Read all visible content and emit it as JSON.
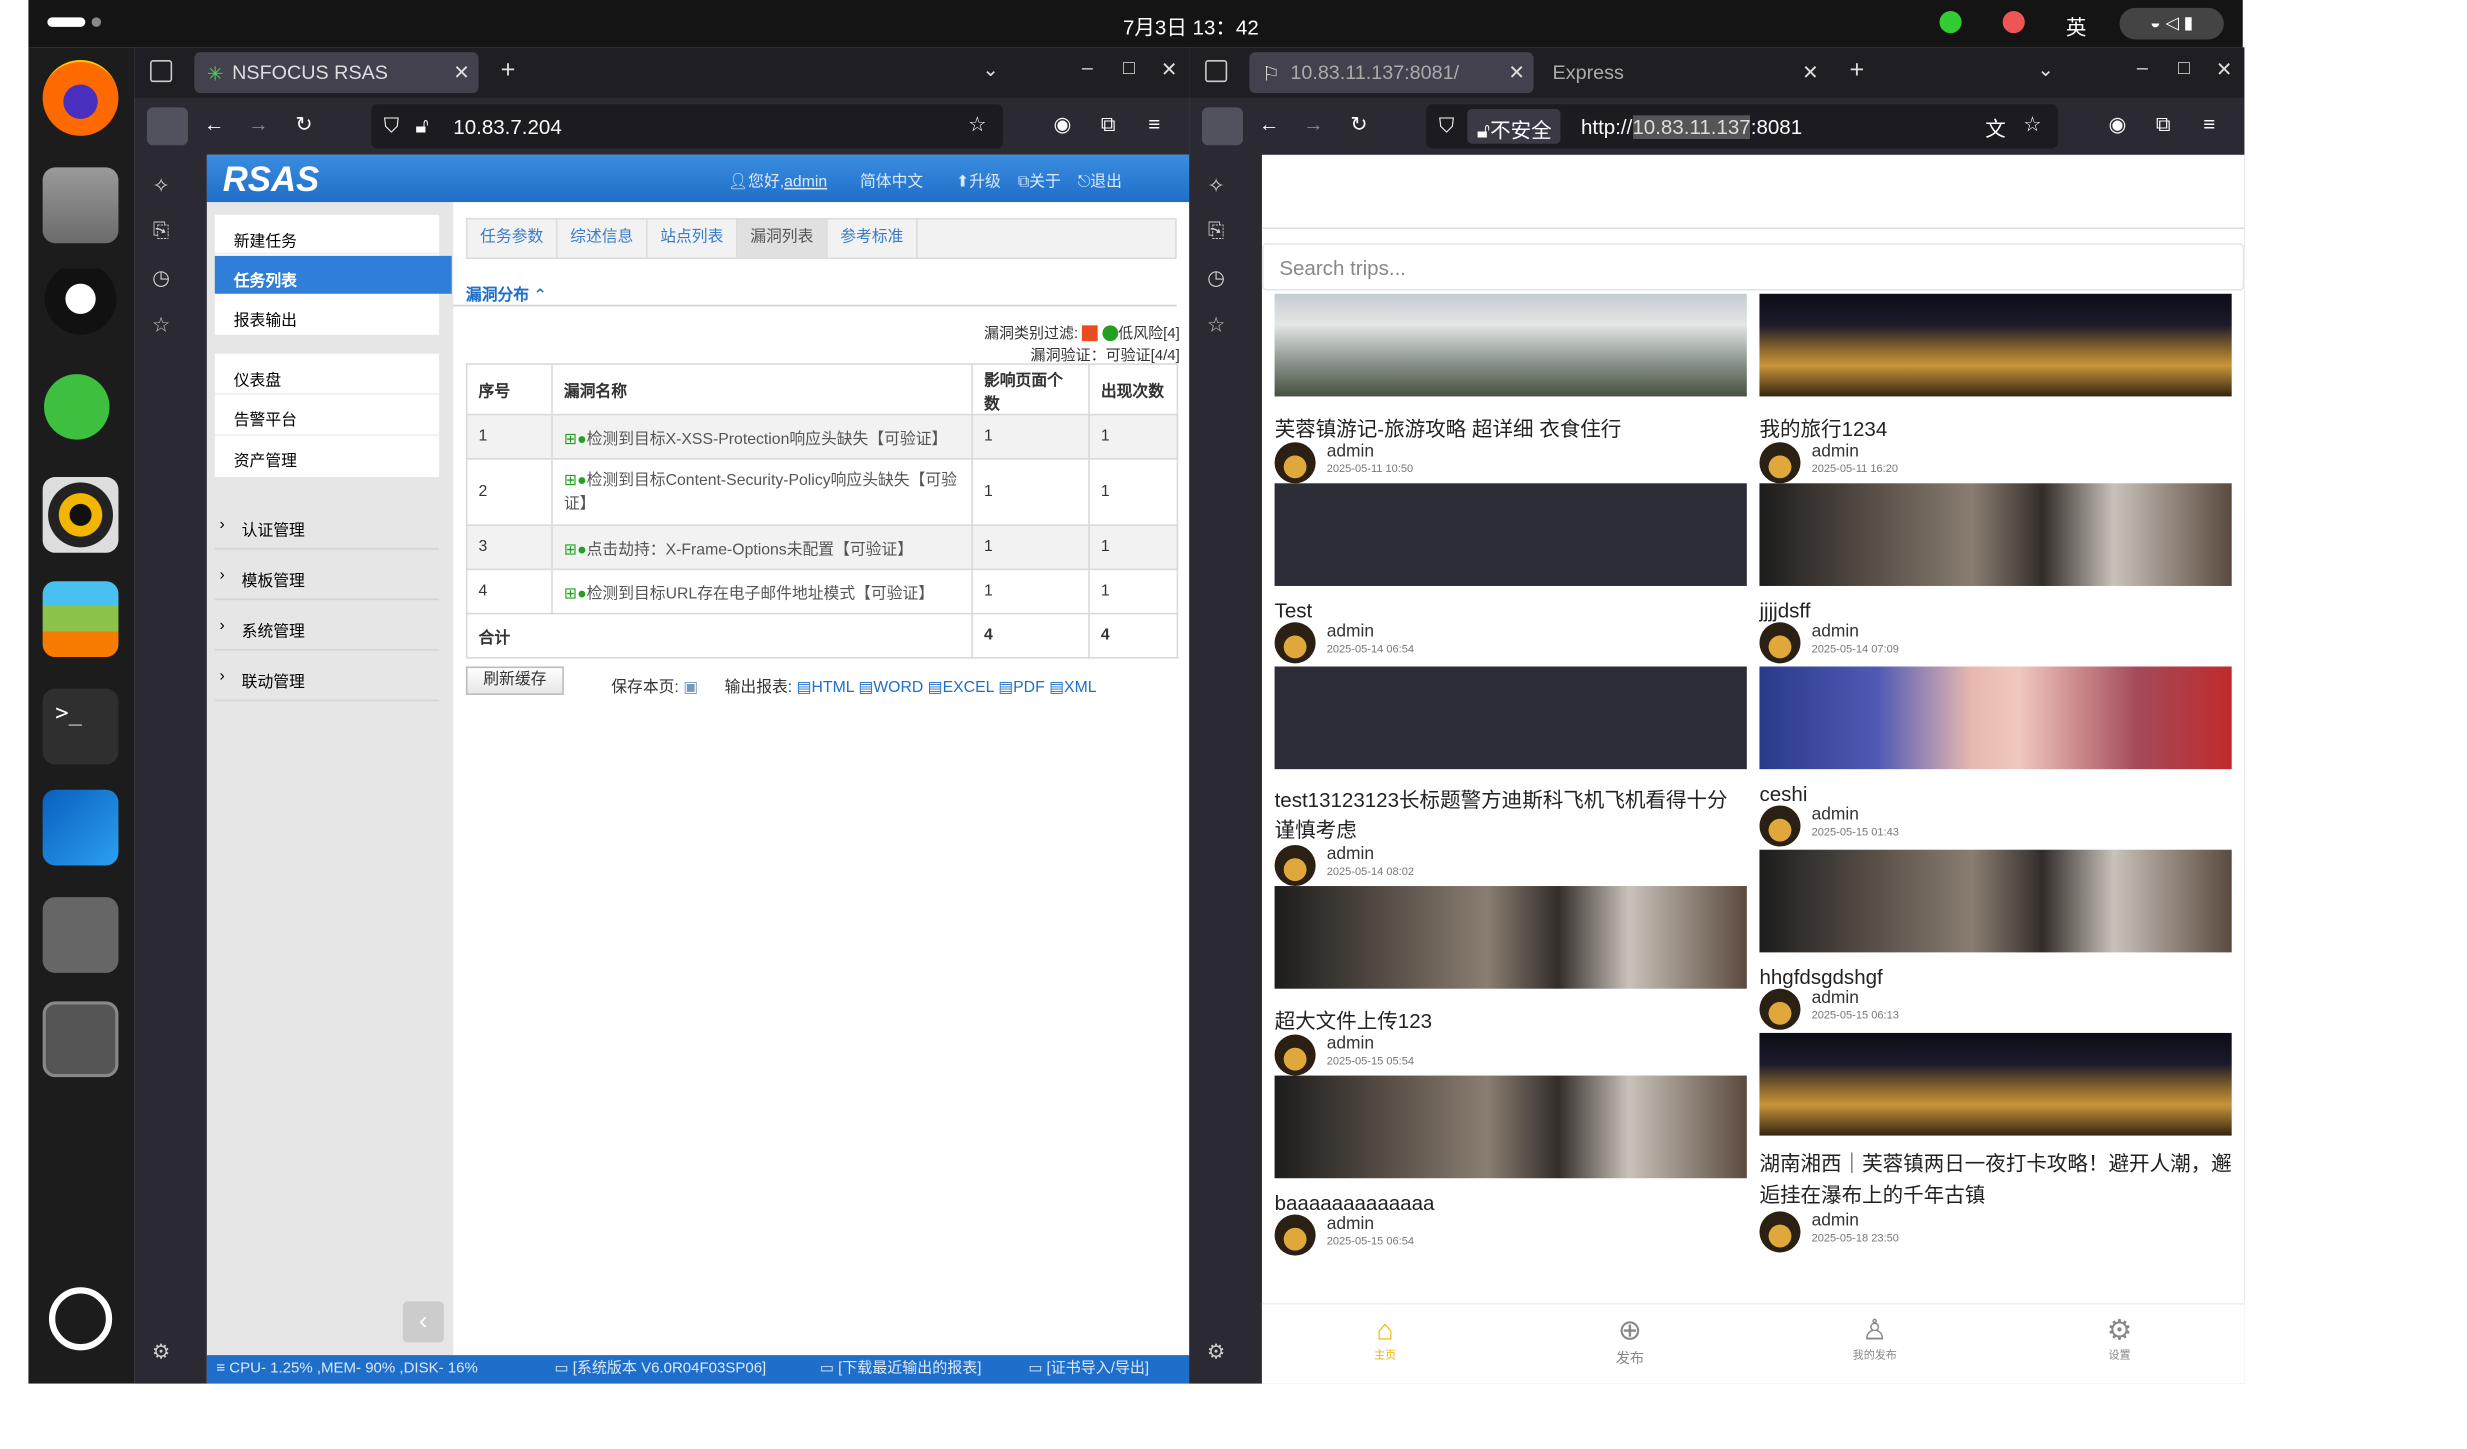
{
  "topbar": {
    "datetime": "7月3日 13：42",
    "ime": "英"
  },
  "win1": {
    "tab_title": "NSFOCUS RSAS",
    "url": "10.83.7.204"
  },
  "rsas": {
    "logo": "RSAS",
    "greeting": "您好,",
    "user": "admin",
    "lang": "简体中文",
    "upgrade": "升级",
    "about": "关于",
    "logout": "退出",
    "menu1": [
      "新建任务",
      "任务列表",
      "报表输出"
    ],
    "menu2": [
      "仪表盘",
      "告警平台",
      "资产管理"
    ],
    "menu3": [
      "认证管理",
      "模板管理",
      "系统管理",
      "联动管理"
    ],
    "tabs": [
      "任务参数",
      "综述信息",
      "站点列表",
      "漏洞列表",
      "参考标准"
    ],
    "section": "漏洞分布",
    "filter_label": "漏洞类别过滤:",
    "filter_low": "低风险[4]",
    "verify": "漏洞验证：可验证[4/4]",
    "headers": [
      "序号",
      "漏洞名称",
      "影响页面个数",
      "出现次数"
    ],
    "rows": [
      {
        "no": "1",
        "name": "检测到目标X-XSS-Protection响应头缺失【可验证】",
        "pages": "1",
        "count": "1"
      },
      {
        "no": "2",
        "name": "检测到目标Content-Security-Policy响应头缺失【可验证】",
        "pages": "1",
        "count": "1"
      },
      {
        "no": "3",
        "name": "点击劫持：X-Frame-Options未配置【可验证】",
        "pages": "1",
        "count": "1"
      },
      {
        "no": "4",
        "name": "检测到目标URL存在电子邮件地址模式【可验证】",
        "pages": "1",
        "count": "1"
      }
    ],
    "total_label": "合计",
    "total_pages": "4",
    "total_count": "4",
    "refresh": "刷新缓存",
    "save_page": "保存本页:",
    "export": "输出报表:",
    "formats": [
      "HTML",
      "WORD",
      "EXCEL",
      "PDF",
      "XML"
    ],
    "status": [
      "CPU- 1.25% ,MEM- 90% ,DISK- 16%",
      "[系统版本 V6.0R04F03SP06]",
      "[下载最近输出的报表]",
      "[证书导入/导出]"
    ]
  },
  "win2": {
    "tab1": "10.83.11.137:8081/",
    "tab2": "Express",
    "insecure": "不安全",
    "url_pre": "http://",
    "url_host": "10.83.11.137",
    "url_post": ":8081"
  },
  "express": {
    "search_placeholder": "Search trips...",
    "left": [
      {
        "title": "芙蓉镇游记-旅游攻略 超详细 衣食住行",
        "author": "admin",
        "date": "2025-05-11 10:50"
      },
      {
        "title": "Test",
        "author": "admin",
        "date": "2025-05-14 06:54"
      },
      {
        "title": "test13123123长标题警方迪斯科飞机飞机看得十分谨慎考虑",
        "author": "admin",
        "date": "2025-05-14 08:02"
      },
      {
        "title": "超大文件上传123",
        "author": "admin",
        "date": "2025-05-15 05:54"
      },
      {
        "title": "baaaaaaaaaaaaa",
        "author": "admin",
        "date": "2025-05-15 06:54"
      }
    ],
    "right": [
      {
        "title": "我的旅行1234",
        "author": "admin",
        "date": "2025-05-11 16:20"
      },
      {
        "title": "jjjjdsff",
        "author": "admin",
        "date": "2025-05-14 07:09"
      },
      {
        "title": "ceshi",
        "author": "admin",
        "date": "2025-05-15 01:43"
      },
      {
        "title": "hhgfdsgdshgf",
        "author": "admin",
        "date": "2025-05-15 06:13"
      },
      {
        "title": "湖南湘西｜芙蓉镇两日一夜打卡攻略！避开人潮，邂逅挂在瀑布上的千年古镇",
        "author": "admin",
        "date": "2025-05-18 23:50"
      }
    ],
    "nav": [
      "主页",
      "发布",
      "我的发布",
      "设置"
    ],
    "accent": "#f5b400"
  }
}
